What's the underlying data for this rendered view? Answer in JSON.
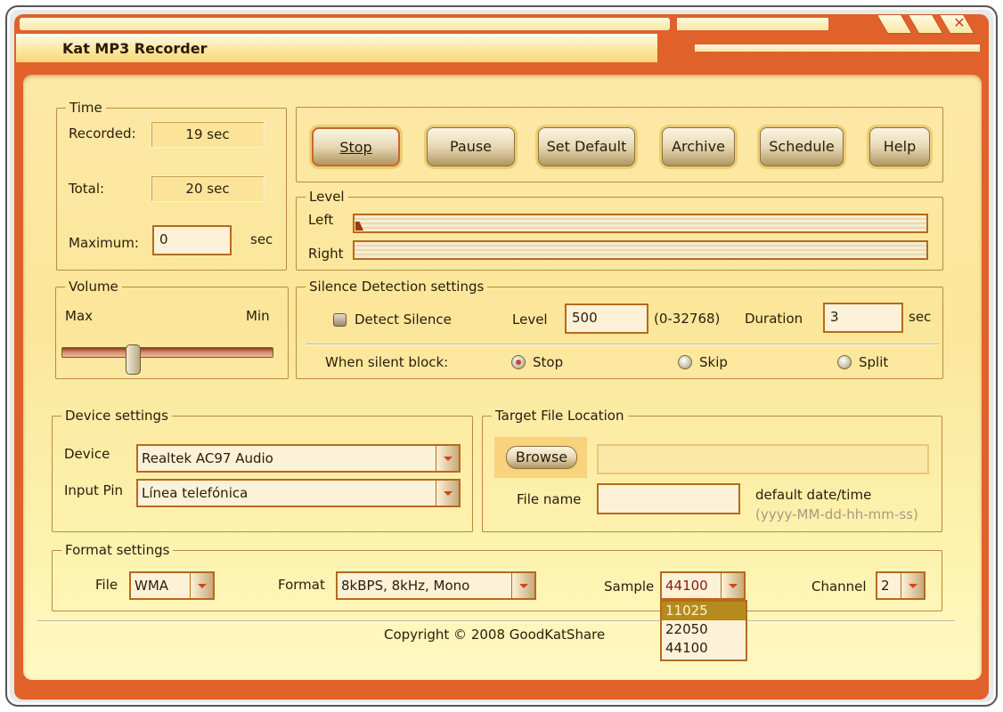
{
  "window": {
    "title": "Kat MP3 Recorder",
    "close_icon": "✕"
  },
  "time": {
    "legend": "Time",
    "recorded_label": "Recorded:",
    "recorded_value": "19 sec",
    "total_label": "Total:",
    "total_value": "20 sec",
    "maximum_label": "Maximum:",
    "maximum_value": "0",
    "maximum_unit": "sec"
  },
  "toolbar": {
    "stop": "Stop",
    "pause": "Pause",
    "set_default": "Set Default",
    "archive": "Archive",
    "schedule": "Schedule",
    "help": "Help"
  },
  "level": {
    "legend": "Level",
    "left_label": "Left",
    "right_label": "Right",
    "left_value": 1,
    "right_value": 0
  },
  "volume": {
    "legend": "Volume",
    "max_label": "Max",
    "min_label": "Min",
    "value_percent": 34
  },
  "silence": {
    "legend": "Silence Detection settings",
    "detect_label": "Detect Silence",
    "detect_checked": false,
    "level_label": "Level",
    "level_value": "500",
    "level_range": "(0-32768)",
    "duration_label": "Duration",
    "duration_value": "3",
    "duration_unit": "sec",
    "when_label": "When silent block:",
    "options": [
      "Stop",
      "Skip",
      "Split"
    ],
    "selected": "Stop"
  },
  "device": {
    "legend": "Device settings",
    "device_label": "Device",
    "device_value": "Realtek AC97 Audio",
    "pin_label": "Input Pin",
    "pin_value": "Línea telefónica"
  },
  "target": {
    "legend": "Target File Location",
    "browse": "Browse",
    "path_value": "",
    "filename_label": "File name",
    "filename_value": "",
    "default_note": "default date/time",
    "format_note": "(yyyy-MM-dd-hh-mm-ss)"
  },
  "format": {
    "legend": "Format settings",
    "file_label": "File",
    "file_value": "WMA",
    "format_label": "Format",
    "format_value": "8kBPS, 8kHz, Mono",
    "sample_label": "Sample",
    "sample_value": "44100",
    "sample_options": [
      "11025",
      "22050",
      "44100"
    ],
    "sample_highlighted": "11025",
    "channel_label": "Channel",
    "channel_value": "2"
  },
  "footer": {
    "copyright": "Copyright © 2008 GoodKatShare"
  }
}
